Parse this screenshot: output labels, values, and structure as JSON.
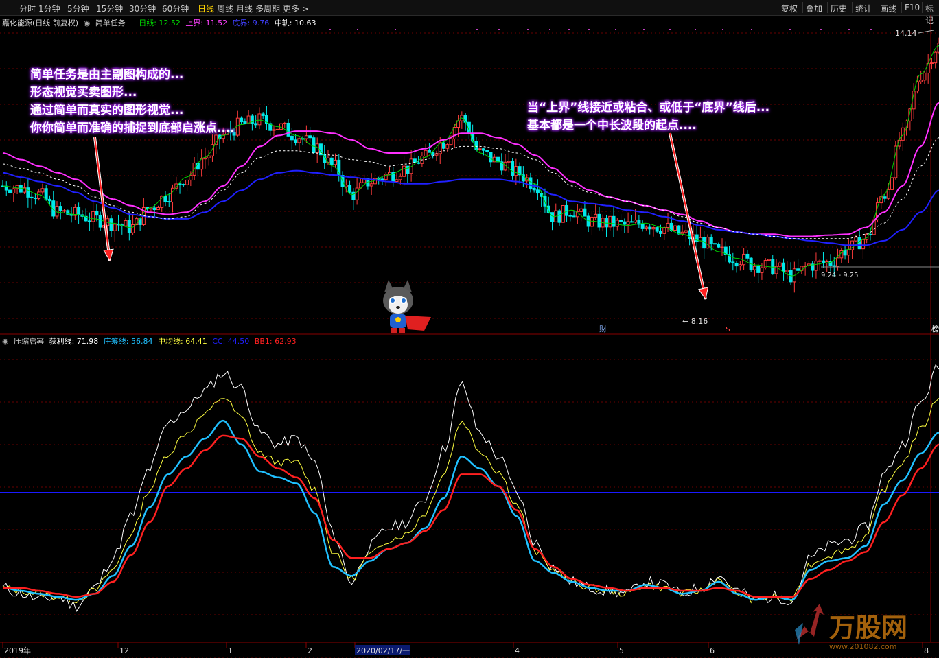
{
  "toolbar": {
    "periods": [
      "分时",
      "1分钟",
      "5分钟",
      "15分钟",
      "30分钟",
      "60分钟",
      "日线",
      "周线",
      "月线",
      "多周期",
      "更多"
    ],
    "active": "日线",
    "right_buttons": [
      "复权",
      "叠加",
      "历史",
      "统计",
      "画线",
      "F10",
      "标记"
    ]
  },
  "main_legend": {
    "stock": "嘉化能源(日线 前复权)",
    "formula": "简单任务",
    "items": [
      {
        "label": "日线: 12.52",
        "color": "#00e000"
      },
      {
        "label": "上界: 11.52",
        "color": "#ff40ff"
      },
      {
        "label": "底界: 9.76",
        "color": "#3030ff"
      },
      {
        "label": "中轨: 10.63",
        "color": "#ffffff"
      }
    ]
  },
  "sub_legend": {
    "formula": "压缩启幂",
    "items": [
      {
        "label": "获利线: 71.98",
        "color": "#ffffff"
      },
      {
        "label": "庄筹线: 56.84",
        "color": "#20c0ff"
      },
      {
        "label": "中均线: 64.41",
        "color": "#ffff40"
      },
      {
        "label": "CC: 44.50",
        "color": "#2020ff"
      },
      {
        "label": "BB1: 62.93",
        "color": "#ff2020"
      }
    ]
  },
  "annotations": {
    "left": [
      "简单任务是由主副图构成的...",
      "形态视觉买卖图形...",
      "通过简单而真实的图形视觉...",
      "你你简单而准确的捕捉到底部启涨点...."
    ],
    "right": [
      "当“上界”线接近或粘合、或低于“底界”线后...",
      "基本都是一个中长波段的起点...."
    ]
  },
  "chart_labels": {
    "high": "14.14",
    "low": "8.16",
    "mid": "9.24 - 9.25",
    "marker_cai": "财",
    "marker_s": "$",
    "marker_right": "榜"
  },
  "x_axis": {
    "labels": [
      "2019年",
      "12",
      "1",
      "2",
      "2020/02/17/一",
      "4",
      "5",
      "6",
      "8"
    ]
  },
  "watermark": {
    "text": "万股网",
    "url": "www.201082.com"
  },
  "chart_data": {
    "type": "line",
    "main": {
      "price_range": [
        7.5,
        14.6
      ],
      "midline": [
        11.3,
        11.2,
        11.1,
        10.95,
        10.8,
        10.55,
        10.35,
        10.2,
        10.1,
        10.05,
        10.1,
        10.4,
        10.7,
        11.1,
        11.45,
        11.6,
        11.6,
        11.55,
        11.5,
        11.4,
        11.35,
        11.25,
        11.3,
        11.4,
        11.6,
        11.7,
        11.7,
        11.65,
        11.55,
        11.4,
        11.1,
        10.8,
        10.65,
        10.55,
        10.45,
        10.35,
        10.25,
        10.1,
        9.95,
        9.85,
        9.75,
        9.7,
        9.65,
        9.6,
        9.6,
        9.6,
        9.6,
        9.7,
        9.95,
        10.5,
        11.25,
        11.9
      ],
      "upper": [
        11.55,
        11.4,
        11.25,
        11.1,
        10.95,
        10.7,
        10.5,
        10.35,
        10.2,
        10.15,
        10.2,
        10.45,
        10.8,
        11.25,
        11.7,
        11.95,
        12.05,
        12.05,
        12.0,
        11.85,
        11.65,
        11.55,
        11.55,
        11.65,
        11.85,
        12.0,
        12.0,
        11.9,
        11.75,
        11.5,
        11.2,
        10.9,
        10.7,
        10.55,
        10.45,
        10.35,
        10.25,
        10.15,
        10.0,
        9.85,
        9.75,
        9.7,
        9.7,
        9.65,
        9.65,
        9.68,
        9.7,
        9.85,
        10.2,
        10.8,
        11.7,
        12.7
      ],
      "lower": [
        11.1,
        11.0,
        10.9,
        10.8,
        10.65,
        10.45,
        10.3,
        10.15,
        10.1,
        10.05,
        10.05,
        10.2,
        10.45,
        10.7,
        10.95,
        11.1,
        11.15,
        11.1,
        11.05,
        11.0,
        10.95,
        10.9,
        10.85,
        10.85,
        10.9,
        10.95,
        10.95,
        10.95,
        10.9,
        10.8,
        10.6,
        10.45,
        10.4,
        10.35,
        10.25,
        10.2,
        10.1,
        10.0,
        9.9,
        9.8,
        9.75,
        9.7,
        9.65,
        9.6,
        9.55,
        9.5,
        9.45,
        9.45,
        9.55,
        9.8,
        10.2,
        10.7
      ],
      "close": [
        10.8,
        10.75,
        10.6,
        10.2,
        10.15,
        10.05,
        9.95,
        9.85,
        10.3,
        10.6,
        11.0,
        11.45,
        11.95,
        12.2,
        12.3,
        12.15,
        11.95,
        11.7,
        11.25,
        10.6,
        10.9,
        11.05,
        11.2,
        11.45,
        11.8,
        12.35,
        11.55,
        11.35,
        11.1,
        10.85,
        10.1,
        10.25,
        10.0,
        9.95,
        9.9,
        9.95,
        9.85,
        9.7,
        9.55,
        9.3,
        9.15,
        9.0,
        8.95,
        8.75,
        9.0,
        9.05,
        9.35,
        9.6,
        10.6,
        11.95,
        13.35,
        14.0
      ]
    },
    "sub": {
      "range": [
        0,
        100
      ],
      "horizontal_line": 50,
      "profit_line": [
        18,
        16,
        14,
        15,
        12,
        18,
        28,
        42,
        58,
        73,
        78,
        84,
        90,
        85,
        70,
        66,
        68,
        60,
        36,
        20,
        32,
        38,
        40,
        48,
        64,
        86,
        70,
        62,
        50,
        33,
        25,
        20,
        18,
        17,
        16,
        20,
        19,
        16,
        18,
        22,
        17,
        14,
        15,
        14,
        28,
        32,
        34,
        38,
        56,
        66,
        80,
        92
      ],
      "chip_line": [
        18,
        17,
        16,
        15,
        14,
        16,
        22,
        32,
        45,
        56,
        62,
        68,
        74,
        66,
        57,
        55,
        53,
        43,
        25,
        22,
        27,
        31,
        33,
        38,
        48,
        62,
        58,
        52,
        42,
        27,
        23,
        20,
        18,
        17,
        17,
        19,
        18,
        16,
        17,
        20,
        16,
        14,
        15,
        14,
        24,
        27,
        28,
        32,
        46,
        54,
        63,
        70
      ],
      "avg_line": [
        18,
        17,
        16,
        15,
        14,
        17,
        24,
        36,
        51,
        63,
        70,
        76,
        82,
        75,
        63,
        60,
        60,
        51,
        30,
        21,
        29,
        34,
        36,
        43,
        56,
        74,
        64,
        57,
        46,
        30,
        24,
        20,
        18,
        17,
        16,
        19,
        18,
        16,
        17,
        21,
        16,
        14,
        15,
        14,
        26,
        29,
        31,
        35,
        51,
        60,
        71,
        82
      ],
      "bb1": [
        18,
        18,
        17,
        16,
        15,
        16,
        20,
        29,
        40,
        52,
        58,
        64,
        69,
        68,
        62,
        58,
        55,
        48,
        34,
        28,
        28,
        31,
        33,
        37,
        44,
        56,
        56,
        52,
        44,
        31,
        25,
        21,
        19,
        18,
        17,
        18,
        18,
        17,
        17,
        18,
        17,
        15,
        15,
        15,
        21,
        24,
        27,
        30,
        40,
        49,
        58,
        66
      ]
    }
  }
}
